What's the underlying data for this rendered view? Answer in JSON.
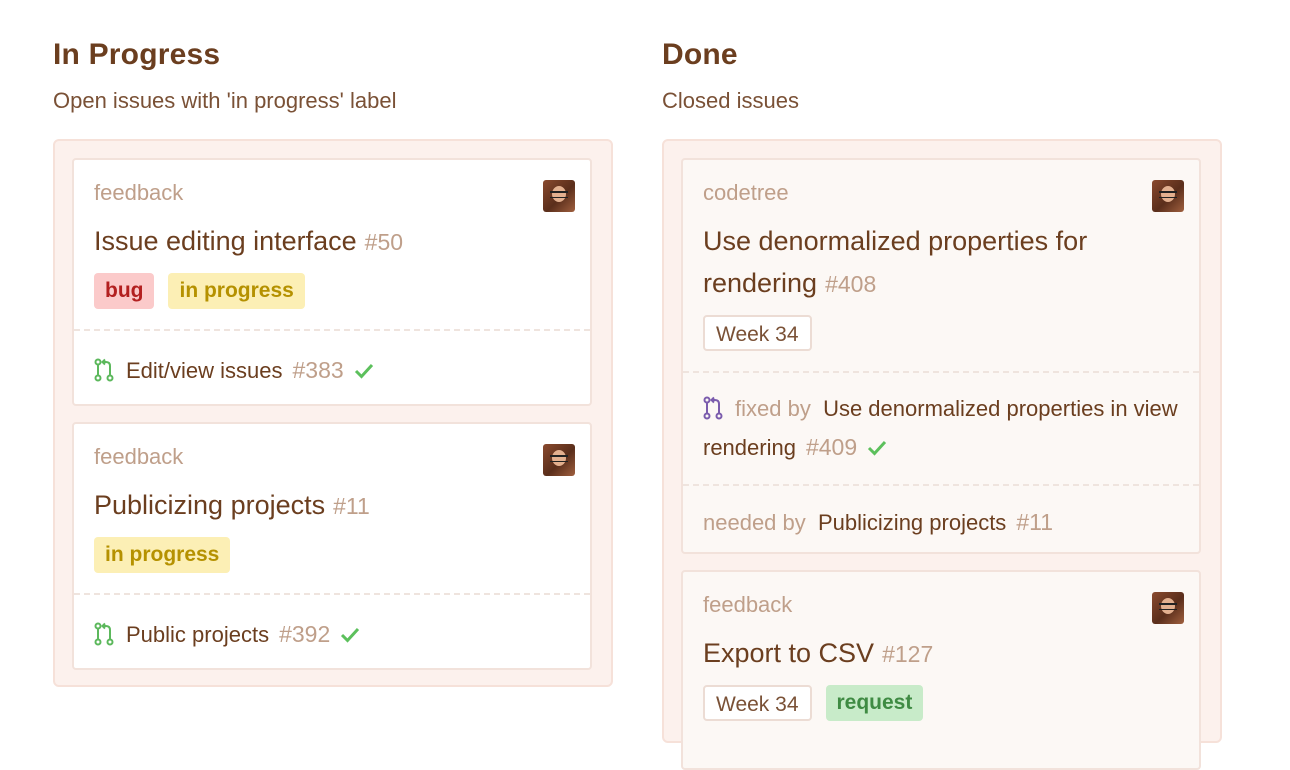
{
  "columns": {
    "in_progress": {
      "title": "In Progress",
      "subtitle": "Open issues with 'in progress' label",
      "cards": [
        {
          "repo": "feedback",
          "title": "Issue editing interface",
          "number": "#50",
          "labels": [
            "bug",
            "in progress"
          ],
          "pr": {
            "title": "Edit/view issues",
            "number": "#383"
          }
        },
        {
          "repo": "feedback",
          "title": "Publicizing projects",
          "number": "#11",
          "labels": [
            "in progress"
          ],
          "pr": {
            "title": "Public projects",
            "number": "#392"
          }
        }
      ]
    },
    "done": {
      "title": "Done",
      "subtitle": "Closed issues",
      "cards": [
        {
          "repo": "codetree",
          "title": "Use denormalized properties for rendering",
          "number": "#408",
          "labels": [
            "Week 34"
          ],
          "fixed_by": {
            "prefix": "fixed by",
            "title": "Use denormalized properties in view rendering",
            "number": "#409"
          },
          "needed_by": {
            "prefix": "needed by",
            "title": "Publicizing projects",
            "number": "#11"
          }
        },
        {
          "repo": "feedback",
          "title": "Export to CSV",
          "number": "#127",
          "labels": [
            "Week 34",
            "request"
          ]
        }
      ]
    }
  },
  "icons": {
    "pr_open": "pull-request-icon",
    "pr_merged": "merged-pull-request-icon",
    "check": "checkmark-icon",
    "avatar": "user-avatar"
  },
  "colors": {
    "title": "#6b3e1f",
    "muted": "#bf9f8a",
    "lane_bg": "#fcf1ed",
    "bug_bg": "#fbcaca",
    "bug_text": "#b32020",
    "progress_bg": "#fcefb5",
    "progress_text": "#b59100",
    "request_bg": "#c8ebc9",
    "request_text": "#3f8b43",
    "open_pr": "#5cb85c",
    "merged_pr": "#7b5cad"
  }
}
